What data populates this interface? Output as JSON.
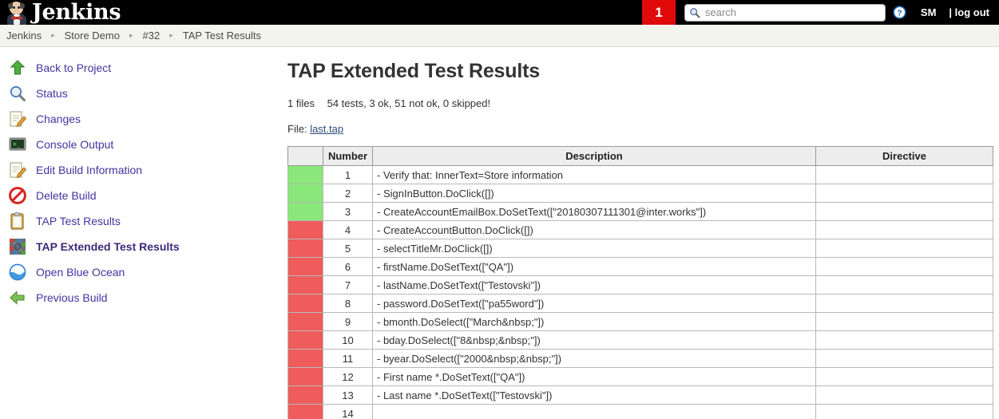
{
  "header": {
    "brand": "Jenkins",
    "brand_icon": "jenkins-butler-icon",
    "notification_count": "1",
    "search_placeholder": "search",
    "search_value": "",
    "search_icon": "search-icon",
    "help_icon": "help-icon",
    "user": "SM",
    "logout": "| log out",
    "background": "#000000",
    "badge_color": "#e00a0a"
  },
  "breadcrumb": {
    "separator": "▸",
    "items": [
      {
        "label": "Jenkins"
      },
      {
        "label": "Store Demo"
      },
      {
        "label": "#32"
      },
      {
        "label": "TAP Test Results"
      }
    ]
  },
  "sidebar": {
    "items": [
      {
        "label": "Back to Project",
        "icon": "up-arrow-icon",
        "active": false
      },
      {
        "label": "Status",
        "icon": "magnifier-icon",
        "active": false
      },
      {
        "label": "Changes",
        "icon": "notepad-pencil-icon",
        "active": false
      },
      {
        "label": "Console Output",
        "icon": "terminal-icon",
        "active": false
      },
      {
        "label": "Edit Build Information",
        "icon": "notepad-pencil-icon",
        "active": false
      },
      {
        "label": "Delete Build",
        "icon": "no-entry-icon",
        "active": false
      },
      {
        "label": "TAP Test Results",
        "icon": "clipboard-icon",
        "active": false
      },
      {
        "label": "TAP Extended Test Results",
        "icon": "mosaic-icon",
        "active": true
      },
      {
        "label": "Open Blue Ocean",
        "icon": "blue-ocean-icon",
        "active": false
      },
      {
        "label": "Previous Build",
        "icon": "left-arrow-icon",
        "active": false
      }
    ]
  },
  "main": {
    "title": "TAP Extended Test Results",
    "files_count": "1 files",
    "summary": "54 tests, 3 ok, 51 not ok, 0 skipped!",
    "file_label": "File:",
    "file_link": "last.tap",
    "table": {
      "columns": [
        "",
        "Number",
        "Description",
        "Directive"
      ],
      "rows": [
        {
          "status": "ok",
          "number": "1",
          "description": "- Verify that: InnerText=Store information",
          "directive": ""
        },
        {
          "status": "ok",
          "number": "2",
          "description": "- SignInButton.DoClick([])",
          "directive": ""
        },
        {
          "status": "ok",
          "number": "3",
          "description": "- CreateAccountEmailBox.DoSetText([\"20180307111301@inter.works\"])",
          "directive": ""
        },
        {
          "status": "not_ok",
          "number": "4",
          "description": "- CreateAccountButton.DoClick([])",
          "directive": ""
        },
        {
          "status": "not_ok",
          "number": "5",
          "description": "- selectTitleMr.DoClick([])",
          "directive": ""
        },
        {
          "status": "not_ok",
          "number": "6",
          "description": "- firstName.DoSetText([\"QA\"])",
          "directive": ""
        },
        {
          "status": "not_ok",
          "number": "7",
          "description": "- lastName.DoSetText([\"Testovski\"])",
          "directive": ""
        },
        {
          "status": "not_ok",
          "number": "8",
          "description": "- password.DoSetText([\"pa55word\"])",
          "directive": ""
        },
        {
          "status": "not_ok",
          "number": "9",
          "description": "- bmonth.DoSelect([\"March&nbsp;\"])",
          "directive": ""
        },
        {
          "status": "not_ok",
          "number": "10",
          "description": "- bday.DoSelect([\"8&nbsp;&nbsp;\"])",
          "directive": ""
        },
        {
          "status": "not_ok",
          "number": "11",
          "description": "- byear.DoSelect([\"2000&nbsp;&nbsp;\"])",
          "directive": ""
        },
        {
          "status": "not_ok",
          "number": "12",
          "description": "- First name *.DoSetText([\"QA\"])",
          "directive": ""
        },
        {
          "status": "not_ok",
          "number": "13",
          "description": "- Last name *.DoSetText([\"Testovski\"])",
          "directive": ""
        },
        {
          "status": "not_ok",
          "number": "14",
          "description": "",
          "directive": ""
        }
      ]
    }
  },
  "colors": {
    "ok": "#8ae87a",
    "not_ok": "#ef5c5c",
    "link": "#4633a0",
    "header_bg": "#ededed"
  }
}
